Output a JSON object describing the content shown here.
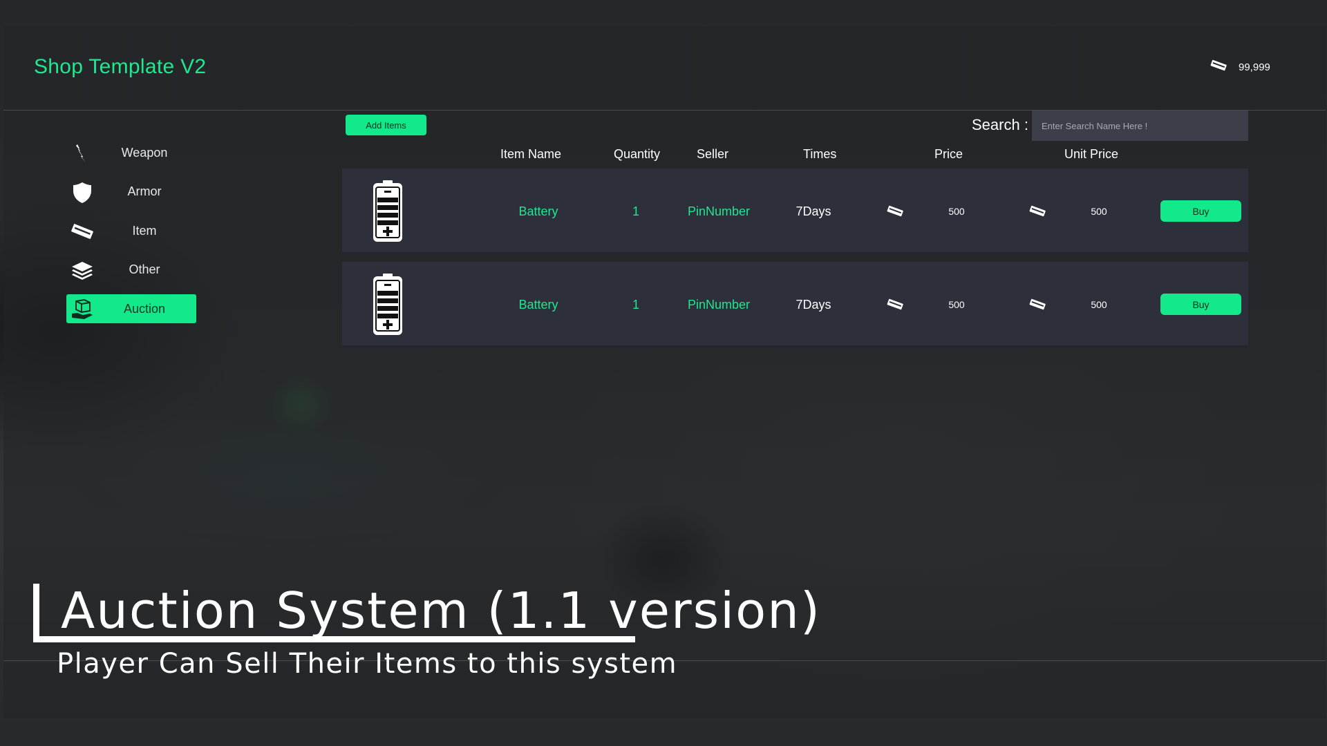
{
  "app": {
    "title": "Shop Template V2"
  },
  "wallet": {
    "icon": "money-icon",
    "balance": "99,999"
  },
  "sidebar": {
    "items": [
      {
        "label": "Weapon",
        "icon": "weapon-icon",
        "active": false
      },
      {
        "label": "Armor",
        "icon": "shield-icon",
        "active": false
      },
      {
        "label": "Item",
        "icon": "money-icon",
        "active": false
      },
      {
        "label": "Other",
        "icon": "layers-icon",
        "active": false
      },
      {
        "label": "Auction",
        "icon": "auction-box-icon",
        "active": true
      }
    ]
  },
  "toolbar": {
    "add_items_label": "Add Items",
    "search_label": "Search :",
    "search_placeholder": "Enter Search Name Here !",
    "search_value": ""
  },
  "table": {
    "headers": [
      "Item Name",
      "Quantity",
      "Seller",
      "Times",
      "Price",
      "Unit Price"
    ],
    "rows": [
      {
        "icon": "battery-icon",
        "item_name": "Battery",
        "quantity": "1",
        "seller": "PinNumber",
        "times": "7Days",
        "price": "500",
        "unit_price": "500",
        "buy_label": "Buy"
      },
      {
        "icon": "battery-icon",
        "item_name": "Battery",
        "quantity": "1",
        "seller": "PinNumber",
        "times": "7Days",
        "price": "500",
        "unit_price": "500",
        "buy_label": "Buy"
      }
    ]
  },
  "promo": {
    "title": "Auction System (1.1 version)",
    "subtitle": "Player Can Sell Their Items to this system"
  },
  "colors": {
    "accent": "#13e98a",
    "title_green": "#1fe88f",
    "row_bg": "#2d2f3b",
    "search_bg": "#3c3e4a"
  }
}
